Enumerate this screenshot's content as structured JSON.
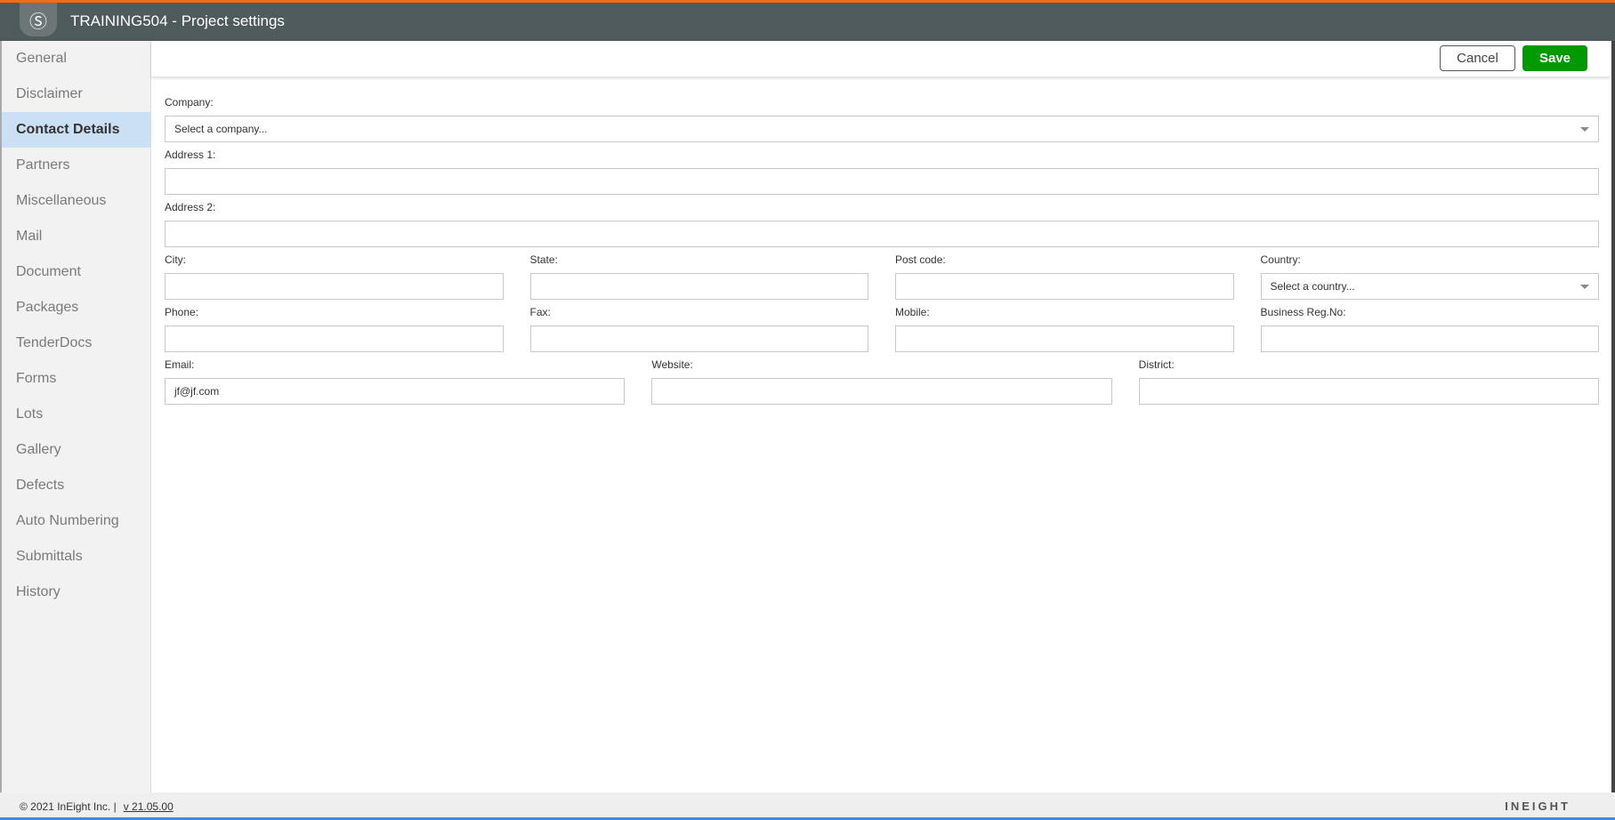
{
  "header": {
    "title": "TRAINING504 - Project settings"
  },
  "sidebar": {
    "items": [
      {
        "label": "General"
      },
      {
        "label": "Disclaimer"
      },
      {
        "label": "Contact Details",
        "active": true
      },
      {
        "label": "Partners"
      },
      {
        "label": "Miscellaneous"
      },
      {
        "label": "Mail"
      },
      {
        "label": "Document"
      },
      {
        "label": "Packages"
      },
      {
        "label": "TenderDocs"
      },
      {
        "label": "Forms"
      },
      {
        "label": "Lots"
      },
      {
        "label": "Gallery"
      },
      {
        "label": "Defects"
      },
      {
        "label": "Auto Numbering"
      },
      {
        "label": "Submittals"
      },
      {
        "label": "History"
      }
    ]
  },
  "toolbar": {
    "cancel": "Cancel",
    "save": "Save"
  },
  "form": {
    "company": {
      "label": "Company:",
      "value": "Select a company..."
    },
    "address1": {
      "label": "Address 1:",
      "value": ""
    },
    "address2": {
      "label": "Address 2:",
      "value": ""
    },
    "city": {
      "label": "City:",
      "value": ""
    },
    "state": {
      "label": "State:",
      "value": ""
    },
    "postcode": {
      "label": "Post code:",
      "value": ""
    },
    "country": {
      "label": "Country:",
      "value": "Select a country..."
    },
    "phone": {
      "label": "Phone:",
      "value": ""
    },
    "fax": {
      "label": "Fax:",
      "value": ""
    },
    "mobile": {
      "label": "Mobile:",
      "value": ""
    },
    "bizreg": {
      "label": "Business Reg.No:",
      "value": ""
    },
    "email": {
      "label": "Email:",
      "value": "jf@jf.com"
    },
    "website": {
      "label": "Website:",
      "value": ""
    },
    "district": {
      "label": "District:",
      "value": ""
    }
  },
  "footer": {
    "copyright": "© 2021 InEight Inc.  |",
    "version": "v 21.05.00",
    "brand": "INEIGHT"
  }
}
